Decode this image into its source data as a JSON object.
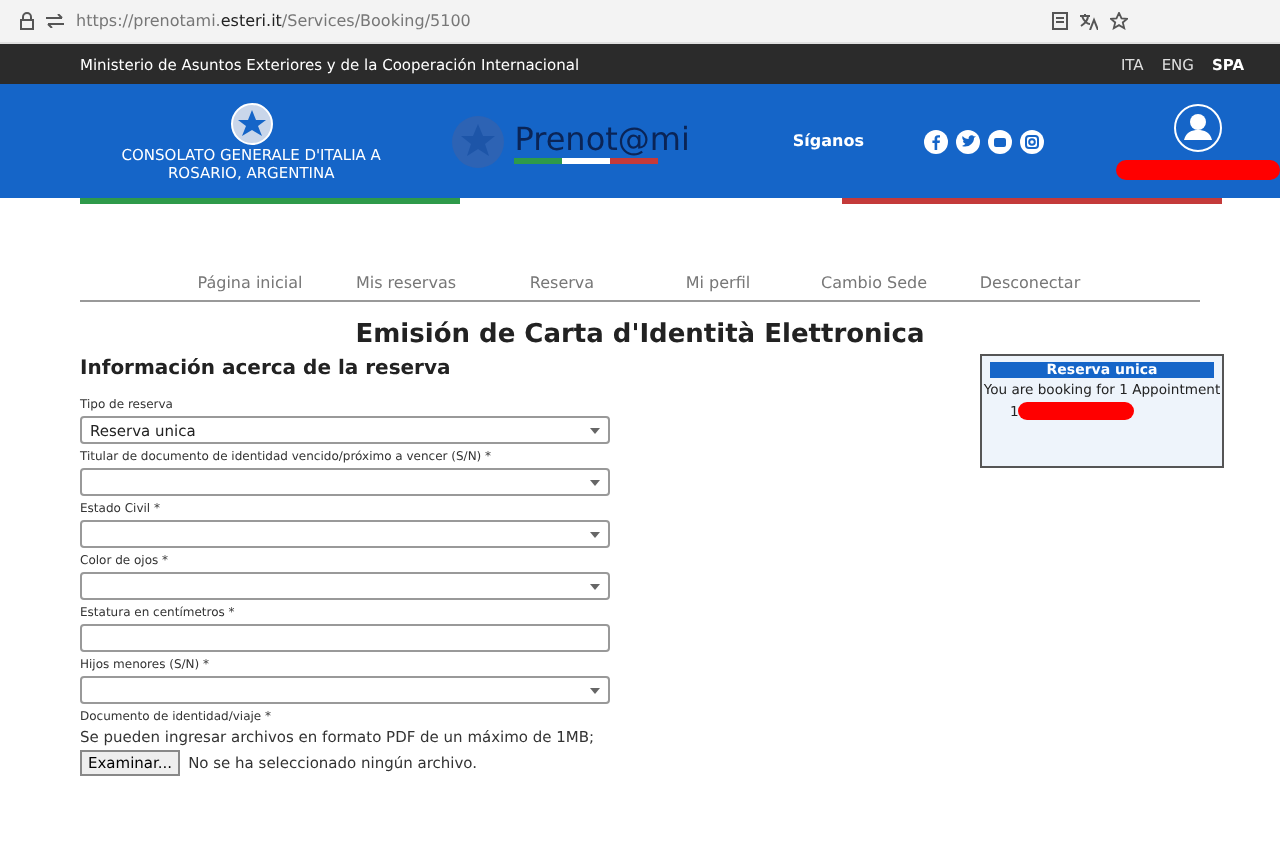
{
  "browser": {
    "url_prefix": "https://prenotami.",
    "url_domain": "esteri.it",
    "url_path": "/Services/Booking/5100"
  },
  "topbar": {
    "ministry": "Ministerio de Asuntos Exteriores y de la Cooperación Internacional",
    "languages": [
      {
        "label": "ITA",
        "selected": false
      },
      {
        "label": "ENG",
        "selected": false
      },
      {
        "label": "SPA",
        "selected": true
      }
    ]
  },
  "header": {
    "consulate_line1": "CONSOLATO GENERALE D'ITALIA A",
    "consulate_line2": "ROSARIO, ARGENTINA",
    "logo_text": "Prenot@mi",
    "follow_label": "Síganos"
  },
  "nav": [
    {
      "label": "Página inicial"
    },
    {
      "label": "Mis reservas"
    },
    {
      "label": "Reserva"
    },
    {
      "label": "Mi perfil"
    },
    {
      "label": "Cambio Sede"
    },
    {
      "label": "Desconectar"
    }
  ],
  "title": "Emisión de Carta d'Identità Elettronica",
  "form": {
    "heading": "Información acerca de la reserva",
    "fields": [
      {
        "kind": "select",
        "label": "Tipo de reserva",
        "value": "Reserva unica"
      },
      {
        "kind": "select",
        "label": "Titular de documento de identidad vencido/próximo a vencer (S/N)  *"
      },
      {
        "kind": "select",
        "label": "Estado Civil  *"
      },
      {
        "kind": "select",
        "label": "Color de ojos  *"
      },
      {
        "kind": "text",
        "label": "Estatura en centímetros  *"
      },
      {
        "kind": "select",
        "label": "Hijos menores (S/N)  *"
      },
      {
        "kind": "file",
        "label": "Documento de identidad/viaje  *",
        "hint": "Se pueden ingresar archivos en formato PDF de un máximo de 1MB;",
        "button": "Examinar...",
        "status": "No se ha seleccionado ningún archivo."
      }
    ]
  },
  "summary": {
    "title": "Reserva unica",
    "text": "You are booking for 1 Appointment",
    "index": "1"
  }
}
